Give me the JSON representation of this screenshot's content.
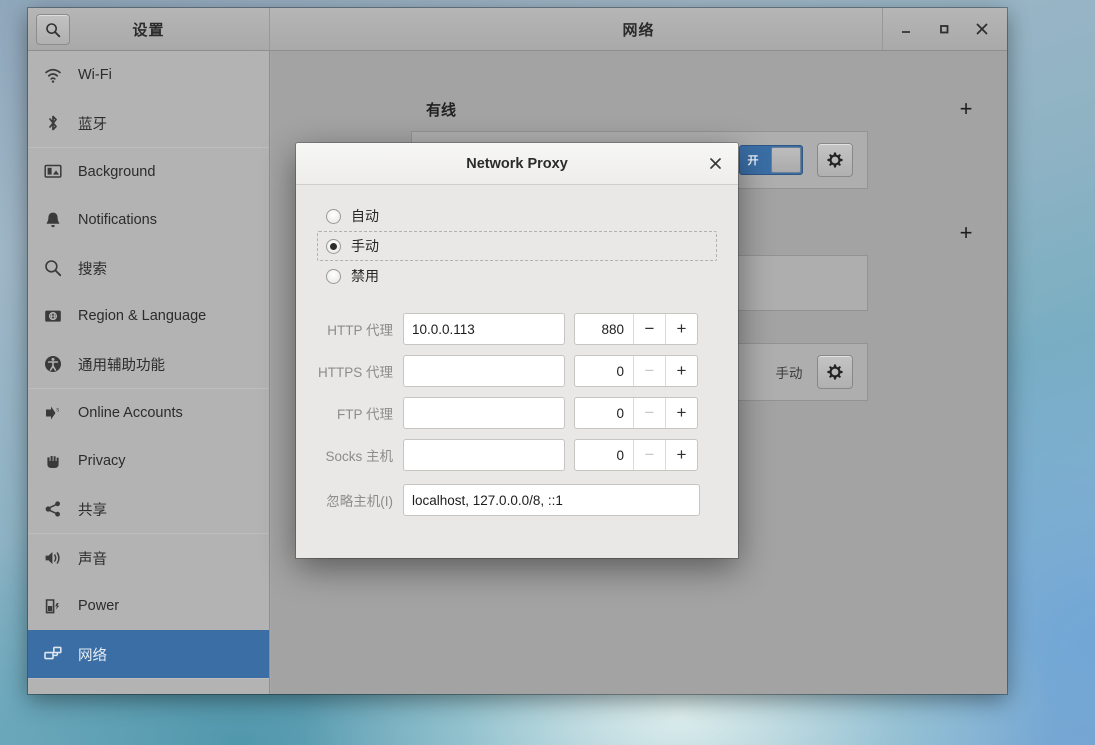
{
  "window": {
    "sidebar_title": "设置",
    "content_title": "网络",
    "search_icon": "search-icon",
    "controls": {
      "minimize": "—",
      "maximize": "□",
      "close": "✕"
    }
  },
  "sidebar": {
    "groups": [
      {
        "items": [
          {
            "label": "Wi-Fi",
            "icon": "wifi-icon",
            "selected": false
          },
          {
            "label": "蓝牙",
            "icon": "bluetooth-icon",
            "selected": false
          }
        ]
      },
      {
        "items": [
          {
            "label": "Background",
            "icon": "background-icon",
            "selected": false
          },
          {
            "label": "Notifications",
            "icon": "bell-icon",
            "selected": false
          },
          {
            "label": "搜索",
            "icon": "search-icon",
            "selected": false
          },
          {
            "label": "Region & Language",
            "icon": "region-language-icon",
            "selected": false
          },
          {
            "label": "通用辅助功能",
            "icon": "accessibility-icon",
            "selected": false
          }
        ]
      },
      {
        "items": [
          {
            "label": "Online Accounts",
            "icon": "online-accounts-icon",
            "selected": false
          },
          {
            "label": "Privacy",
            "icon": "hand-icon",
            "selected": false
          },
          {
            "label": "共享",
            "icon": "share-icon",
            "selected": false
          }
        ]
      },
      {
        "items": [
          {
            "label": "声音",
            "icon": "speaker-icon",
            "selected": false
          },
          {
            "label": "Power",
            "icon": "battery-icon",
            "selected": false
          },
          {
            "label": "网络",
            "icon": "network-icon",
            "selected": true
          }
        ]
      }
    ]
  },
  "content": {
    "sections": [
      {
        "title": "有线",
        "add_button": "+",
        "rows": [
          {
            "label": "",
            "toggle": "on",
            "toggle_label": "开",
            "gear": "gear-icon"
          }
        ]
      },
      {
        "title": "",
        "add_button": "+",
        "rows": [
          {
            "label": "",
            "toggle": null,
            "gear": null
          }
        ]
      },
      {
        "title": "",
        "add_button": "",
        "rows": [
          {
            "label": "手动",
            "toggle": null,
            "gear": "gear-icon"
          }
        ]
      }
    ]
  },
  "dialog": {
    "title": "Network Proxy",
    "close_icon": "close-icon",
    "radios": [
      {
        "label": "自动",
        "checked": false,
        "focused": false
      },
      {
        "label": "手动",
        "checked": true,
        "focused": true
      },
      {
        "label": "禁用",
        "checked": false,
        "focused": false
      }
    ],
    "fields": [
      {
        "label": "HTTP 代理",
        "host": "10.0.0.113",
        "port": "880",
        "minus_enabled": true,
        "minus": "−",
        "plus": "+"
      },
      {
        "label": "HTTPS 代理",
        "host": "",
        "port": "0",
        "minus_enabled": false,
        "minus": "−",
        "plus": "+"
      },
      {
        "label": "FTP 代理",
        "host": "",
        "port": "0",
        "minus_enabled": false,
        "minus": "−",
        "plus": "+"
      },
      {
        "label": "Socks 主机",
        "host": "",
        "port": "0",
        "minus_enabled": false,
        "minus": "−",
        "plus": "+"
      }
    ],
    "ignore": {
      "label": "忽略主机(I)",
      "value": "localhost, 127.0.0.0/8, ::1"
    }
  },
  "colors": {
    "selection_blue": "#3a6ea5",
    "window_gray": "#a8a8a8",
    "sidebar_gray": "#b3b3b3",
    "dialog_gray": "#e9e8e6"
  }
}
